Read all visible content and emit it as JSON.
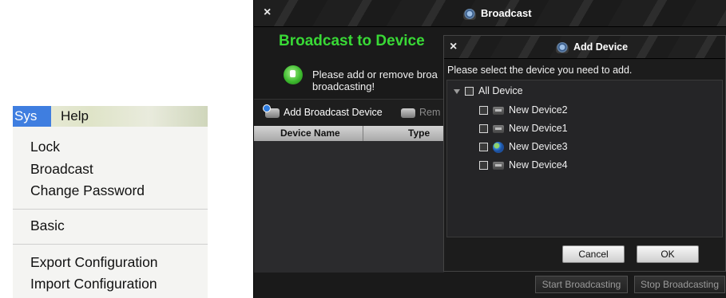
{
  "sys_menu": {
    "menubar": {
      "sys": "Sys",
      "help": "Help"
    },
    "items": {
      "lock": "Lock",
      "broadcast": "Broadcast",
      "change_password": "Change Password",
      "basic": "Basic",
      "export_configuration": "Export Configuration",
      "import_configuration": "Import Configuration"
    }
  },
  "broadcast_window": {
    "title": "Broadcast",
    "close_icon": "×",
    "heading": "Broadcast to Device",
    "info_text": "Please add or remove broa broadcasting!",
    "toolbar": {
      "add_label": "Add Broadcast Device",
      "remove_label": "Rem"
    },
    "table_headers": {
      "device_name": "Device Name",
      "type": "Type"
    },
    "buttons": {
      "start": "Start Broadcasting",
      "stop": "Stop Broadcasting"
    }
  },
  "add_device_dialog": {
    "title": "Add Device",
    "close_icon": "×",
    "description": "Please select the device you need to add.",
    "tree": {
      "root": {
        "label": "All Device",
        "checked": false
      },
      "devices": [
        {
          "label": "New Device2",
          "icon": "device-icon",
          "checked": false
        },
        {
          "label": "New Device1",
          "icon": "device-icon",
          "checked": false
        },
        {
          "label": "New Device3",
          "icon": "globe-icon",
          "checked": false
        },
        {
          "label": "New Device4",
          "icon": "device-icon",
          "checked": false
        }
      ]
    },
    "buttons": {
      "cancel": "Cancel",
      "ok": "OK"
    }
  },
  "colors": {
    "heading_green": "#39d936",
    "menu_highlight": "#3f7ee0",
    "window_bg": "#1a1a1a"
  }
}
